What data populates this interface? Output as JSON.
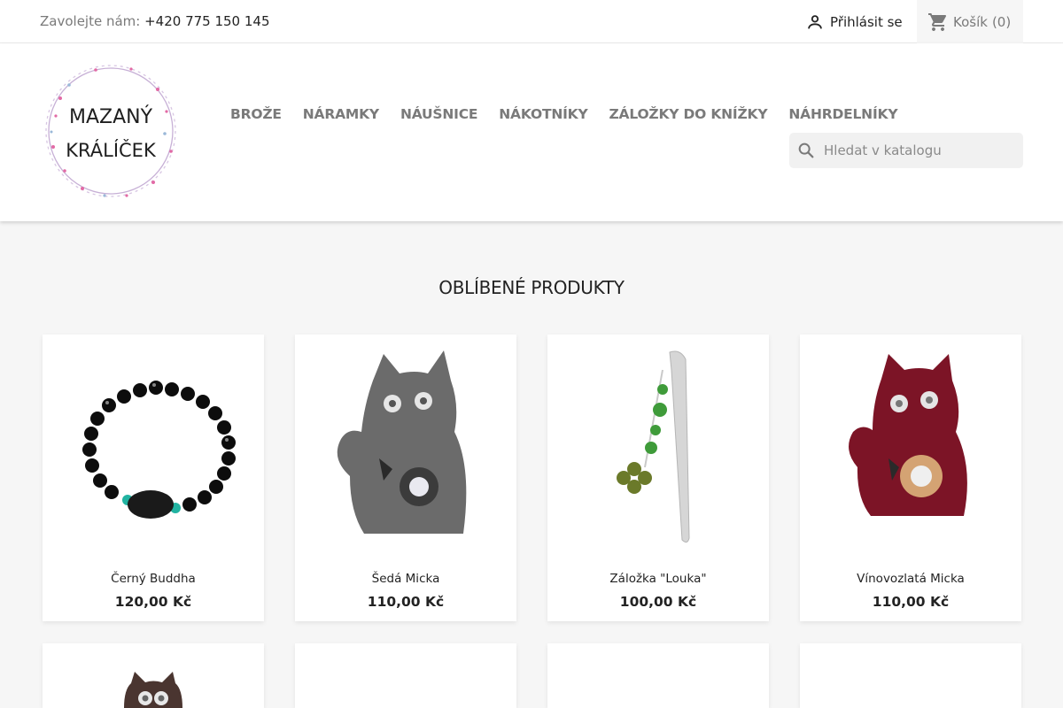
{
  "topbar": {
    "contact_label": "Zavolejte nám:",
    "phone": "+420 775 150 145",
    "login_label": "Přihlásit se",
    "cart_label": "Košík",
    "cart_count": "(0)"
  },
  "logo": {
    "line1": "MAZANÝ",
    "line2": "KRÁLÍČEK"
  },
  "nav": {
    "items": [
      {
        "label": "BROŽE"
      },
      {
        "label": "NÁRAMKY"
      },
      {
        "label": "NÁUŠNICE"
      },
      {
        "label": "NÁKOTNÍKY"
      },
      {
        "label": "ZÁLOŽKY DO KNÍŽKY"
      },
      {
        "label": "NÁHRDELNÍKY"
      }
    ]
  },
  "search": {
    "placeholder": "Hledat v katalogu"
  },
  "section": {
    "title": "OBLÍBENÉ PRODUKTY"
  },
  "products": [
    {
      "name": "Černý Buddha",
      "price": "120,00 Kč"
    },
    {
      "name": "Šedá Micka",
      "price": "110,00 Kč"
    },
    {
      "name": "Záložka \"Louka\"",
      "price": "100,00 Kč"
    },
    {
      "name": "Vínovozlatá Micka",
      "price": "110,00 Kč"
    }
  ],
  "colors": {
    "accent_grey": "#7a7a7a",
    "text": "#232323",
    "background": "#f6f6f6",
    "wine": "#7c1426",
    "felt_grey": "#6b6b6b"
  }
}
